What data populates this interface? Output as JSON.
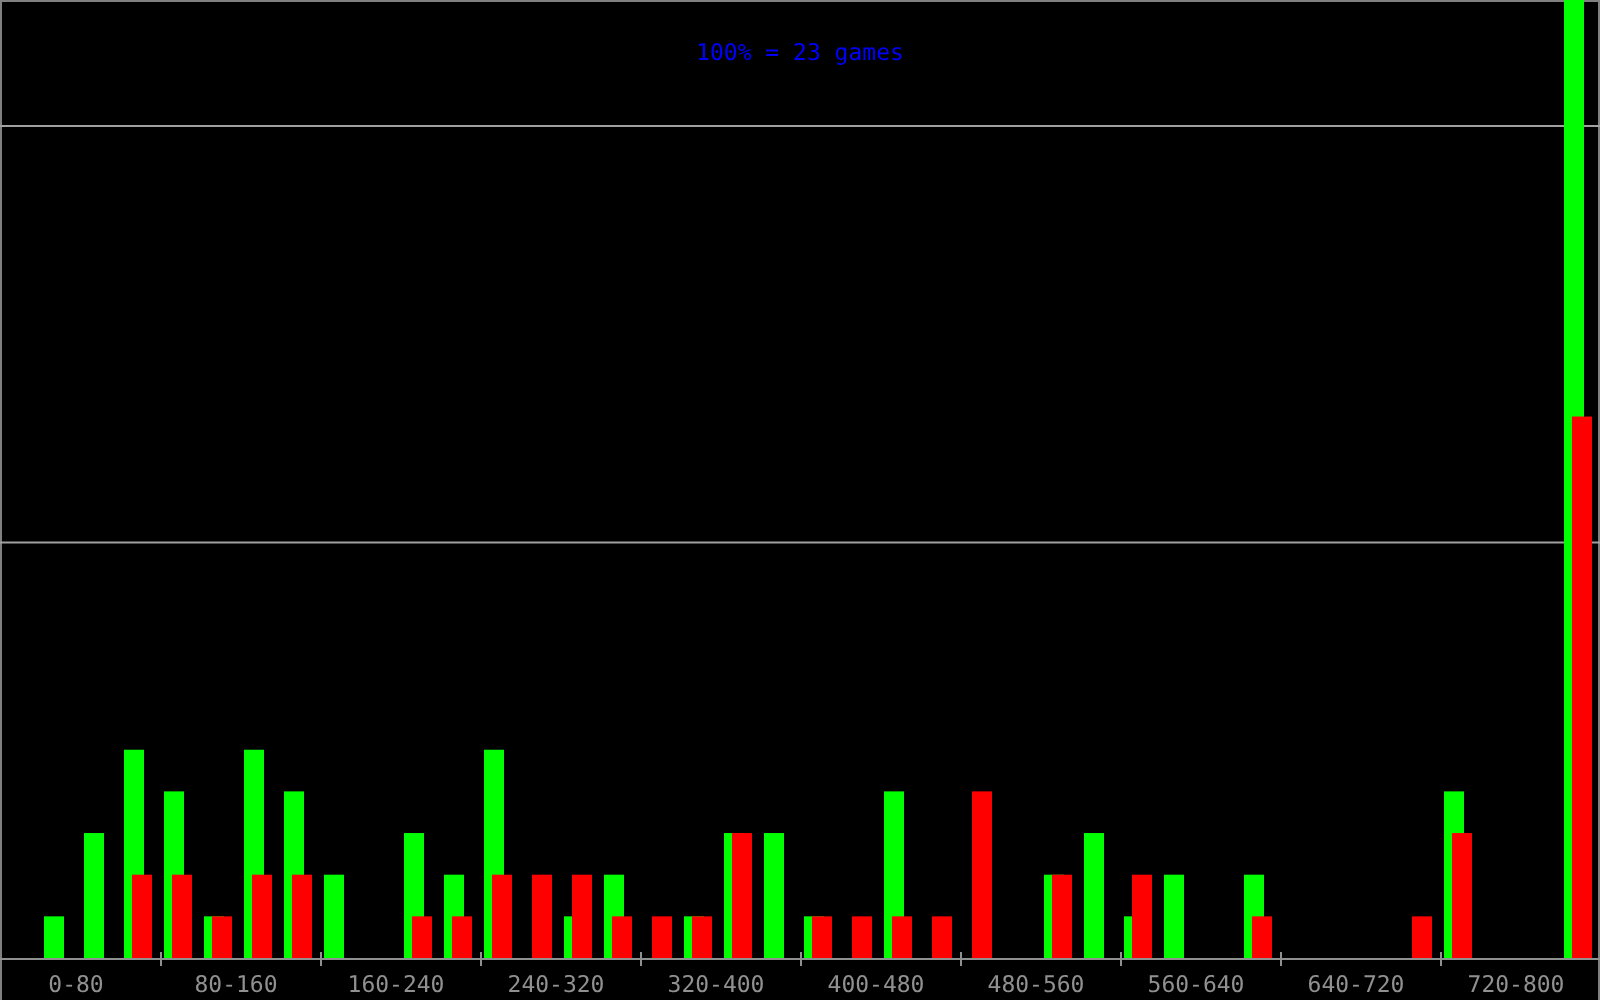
{
  "histogram": {
    "title": "100% = 23 games",
    "axis_labels": [
      "0-80",
      "80-160",
      "160-240",
      "240-320",
      "320-400",
      "400-480",
      "480-560",
      "560-640",
      "640-720",
      "720-800"
    ]
  }
}
